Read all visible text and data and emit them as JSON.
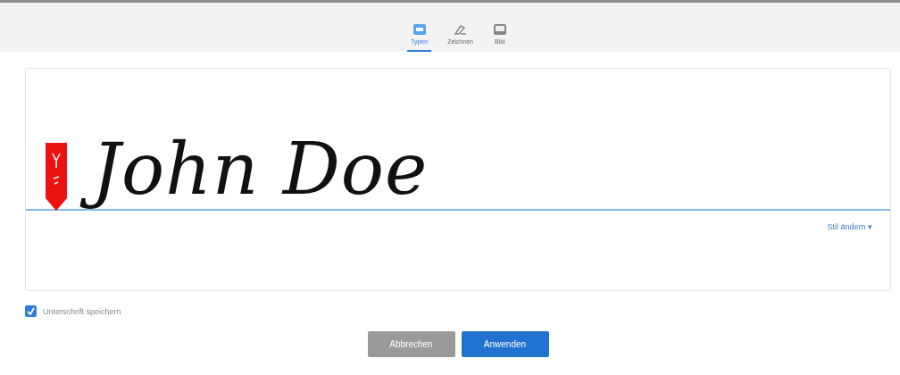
{
  "tabs": [
    {
      "label": "Typen",
      "kind": "type",
      "selected": true
    },
    {
      "label": "Zeichnen",
      "kind": "draw",
      "selected": false
    },
    {
      "label": "Bild",
      "kind": "image",
      "selected": false
    }
  ],
  "signature": {
    "text": "John Doe",
    "style_link": "Stil ändern ▾"
  },
  "save_signature": {
    "label": "Unterschrift speichern",
    "checked": true
  },
  "buttons": [
    {
      "label": "Abbrechen",
      "kind": "secondary"
    },
    {
      "label": "Anwenden",
      "kind": "primary"
    }
  ]
}
